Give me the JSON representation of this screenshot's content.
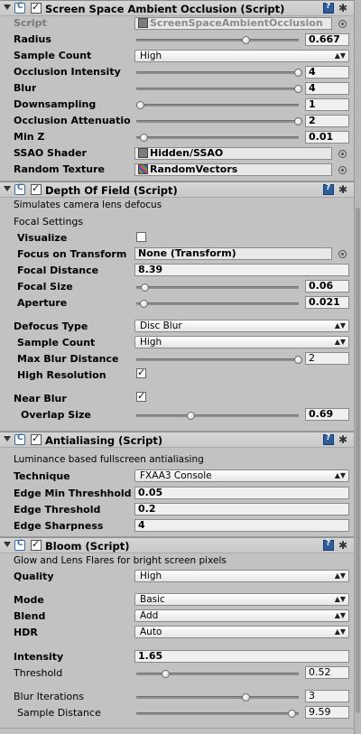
{
  "ssao": {
    "title": "Screen Space Ambient Occlusion (Script)",
    "script_label": "Script",
    "script_value": "ScreenSpaceAmbientOcclusion",
    "radius": {
      "label": "Radius",
      "value": "0.667",
      "fraction": 0.667
    },
    "sample_count": {
      "label": "Sample Count",
      "value": "High"
    },
    "occlusion_intensity": {
      "label": "Occlusion Intensity",
      "value": "4",
      "fraction": 1.0
    },
    "blur": {
      "label": "Blur",
      "value": "4",
      "fraction": 1.0
    },
    "downsampling": {
      "label": "Downsampling",
      "value": "1",
      "fraction": 0.0
    },
    "occlusion_attenuation": {
      "label": "Occlusion Attenuatio",
      "value": "2",
      "fraction": 1.0
    },
    "min_z": {
      "label": "Min Z",
      "value": "0.01",
      "fraction": 0.02
    },
    "ssao_shader": {
      "label": "SSAO Shader",
      "value": "Hidden/SSAO",
      "icon": "shader-icon"
    },
    "random_texture": {
      "label": "Random Texture",
      "value": "RandomVectors",
      "icon": "texture-icon"
    }
  },
  "dof": {
    "title": "Depth Of Field (Script)",
    "description": "Simulates camera lens defocus",
    "focal_settings": "Focal Settings",
    "visualize": {
      "label": "Visualize",
      "checked": false
    },
    "focus_on_transform": {
      "label": "Focus on Transform",
      "value": "None (Transform)"
    },
    "focal_distance": {
      "label": "Focal Distance",
      "value": "8.39"
    },
    "focal_size": {
      "label": "Focal Size",
      "value": "0.06",
      "fraction": 0.03
    },
    "aperture": {
      "label": "Aperture",
      "value": "0.021",
      "fraction": 0.02
    },
    "defocus_type": {
      "label": "Defocus Type",
      "value": "Disc Blur"
    },
    "sample_count": {
      "label": "Sample Count",
      "value": "High"
    },
    "max_blur_distance": {
      "label": "Max Blur Distance",
      "value": "2",
      "fraction": 1.0
    },
    "high_resolution": {
      "label": "High Resolution",
      "checked": true
    },
    "near_blur": {
      "label": "Near Blur",
      "checked": true
    },
    "overlap_size": {
      "label": "Overlap Size",
      "value": "0.69",
      "fraction": 0.32
    }
  },
  "aa": {
    "title": "Antialiasing (Script)",
    "description": "Luminance based fullscreen antialiasing",
    "technique": {
      "label": "Technique",
      "value": "FXAA3 Console"
    },
    "edge_min_threshold": {
      "label": "Edge Min Threshhold",
      "value": "0.05"
    },
    "edge_threshold": {
      "label": "Edge Threshold",
      "value": "0.2"
    },
    "edge_sharpness": {
      "label": "Edge Sharpness",
      "value": "4"
    }
  },
  "bloom": {
    "title": "Bloom (Script)",
    "description": "Glow and Lens Flares for bright screen pixels",
    "quality": {
      "label": "Quality",
      "value": "High"
    },
    "mode": {
      "label": "Mode",
      "value": "Basic"
    },
    "blend": {
      "label": "Blend",
      "value": "Add"
    },
    "hdr": {
      "label": "HDR",
      "value": "Auto"
    },
    "intensity": {
      "label": "Intensity",
      "value": "1.65"
    },
    "threshold": {
      "label": "Threshold",
      "value": "0.52",
      "fraction": 0.16
    },
    "blur_iterations": {
      "label": "Blur Iterations",
      "value": "3",
      "fraction": 0.67
    },
    "sample_distance": {
      "label": "Sample Distance",
      "value": "9.59",
      "fraction": 0.96
    }
  }
}
